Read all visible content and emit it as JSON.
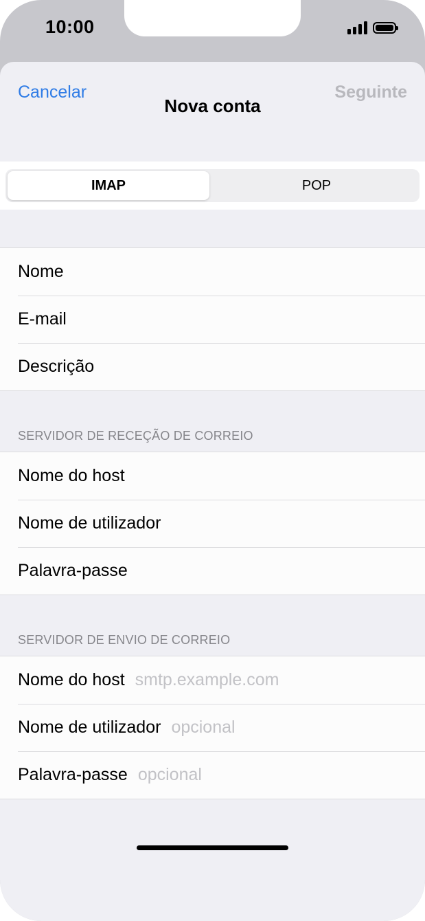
{
  "status_bar": {
    "time": "10:00"
  },
  "nav": {
    "cancel": "Cancelar",
    "title": "Nova conta",
    "next": "Seguinte"
  },
  "segmented": {
    "options": [
      "IMAP",
      "POP"
    ],
    "selected": "IMAP"
  },
  "account_fields": [
    {
      "label": "Nome"
    },
    {
      "label": "E-mail"
    },
    {
      "label": "Descrição"
    }
  ],
  "incoming": {
    "header": "SERVIDOR DE RECEÇÃO DE CORREIO",
    "fields": [
      {
        "label": "Nome do host"
      },
      {
        "label": "Nome de utilizador"
      },
      {
        "label": "Palavra-passe"
      }
    ]
  },
  "outgoing": {
    "header": "SERVIDOR DE ENVIO DE CORREIO",
    "fields": [
      {
        "label": "Nome do host",
        "placeholder": "smtp.example.com"
      },
      {
        "label": "Nome de utilizador",
        "placeholder": "opcional"
      },
      {
        "label": "Palavra-passe",
        "placeholder": "opcional"
      }
    ]
  },
  "colors": {
    "accent": "#2f7ce6",
    "disabled": "#b8b8bd",
    "background": "#efeff4",
    "placeholder": "#c2c2c6"
  },
  "icons": [
    "cellular-signal-icon",
    "battery-icon"
  ]
}
